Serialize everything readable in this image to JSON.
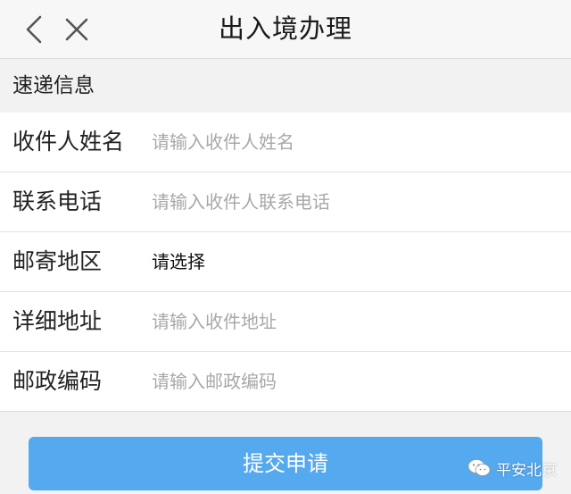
{
  "header": {
    "title": "出入境办理",
    "back_icon": "chevron-left-icon",
    "close_icon": "close-icon"
  },
  "section": {
    "title": "速递信息"
  },
  "form": {
    "recipient_name": {
      "label": "收件人姓名",
      "placeholder": "请输入收件人姓名",
      "value": ""
    },
    "phone": {
      "label": "联系电话",
      "placeholder": "请输入收件人联系电话",
      "value": ""
    },
    "region": {
      "label": "邮寄地区",
      "value": "请选择"
    },
    "address": {
      "label": "详细地址",
      "placeholder": "请输入收件地址",
      "value": ""
    },
    "postal_code": {
      "label": "邮政编码",
      "placeholder": "请输入邮政编码",
      "value": ""
    }
  },
  "actions": {
    "submit_label": "提交申请"
  },
  "watermark": {
    "text": "平安北京",
    "icon": "wechat-icon"
  },
  "colors": {
    "accent": "#55a9ee",
    "placeholder": "#a8a8a8",
    "background": "#f2f2f2"
  }
}
